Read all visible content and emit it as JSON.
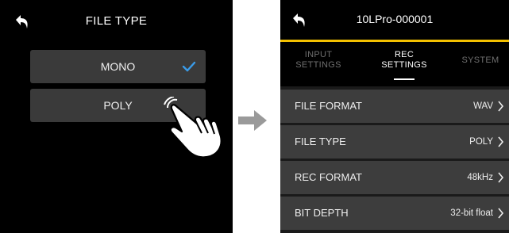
{
  "left": {
    "title": "FILE TYPE",
    "options": [
      {
        "label": "MONO",
        "selected": true
      },
      {
        "label": "POLY",
        "selected": false
      }
    ],
    "accent": "#3a9be8"
  },
  "right": {
    "device_name": "10LPro-000001",
    "tabs": [
      {
        "label": "INPUT\nSETTINGS",
        "active": false
      },
      {
        "label": "REC\nSETTINGS",
        "active": true
      },
      {
        "label": "SYSTEM",
        "active": false
      }
    ],
    "rows": [
      {
        "label": "FILE FORMAT",
        "value": "WAV"
      },
      {
        "label": "FILE TYPE",
        "value": "POLY"
      },
      {
        "label": "REC FORMAT",
        "value": "48kHz"
      },
      {
        "label": "BIT DEPTH",
        "value": "32-bit float"
      }
    ],
    "accent": "#f3c000"
  },
  "icons": {
    "back": "back-arrow-icon",
    "check": "checkmark-icon",
    "chevron": "chevron-right-icon",
    "hand": "tapping-hand-icon",
    "transition": "right-arrow-icon"
  }
}
